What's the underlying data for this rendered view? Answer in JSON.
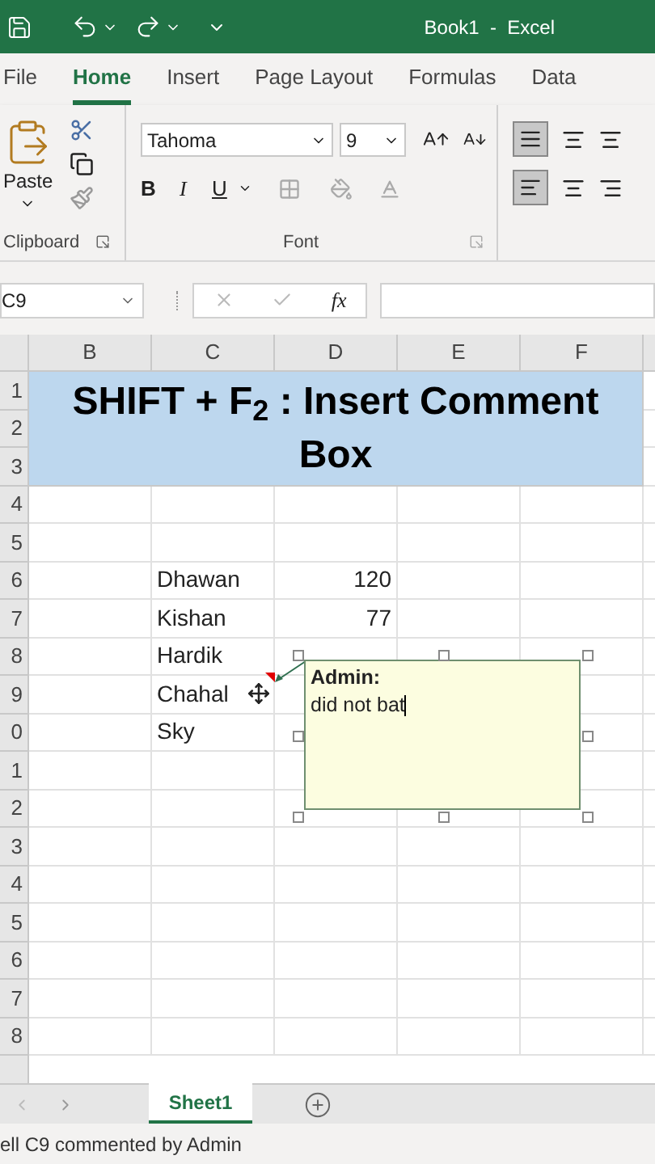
{
  "title_bar": {
    "title": "Book1  -  Excel"
  },
  "ribbon_tabs": [
    {
      "label": "File",
      "selected": false
    },
    {
      "label": "Home",
      "selected": true
    },
    {
      "label": "Insert",
      "selected": false
    },
    {
      "label": "Page Layout",
      "selected": false
    },
    {
      "label": "Formulas",
      "selected": false
    },
    {
      "label": "Data",
      "selected": false
    }
  ],
  "ribbon": {
    "paste_label": "Paste",
    "clipboard_label": "Clipboard",
    "font_name": "Tahoma",
    "font_size": "9",
    "bold": "B",
    "italic": "I",
    "underline": "U",
    "font_label": "Font"
  },
  "formula_bar": {
    "name_box": "C9",
    "function_label": "fx"
  },
  "sheet": {
    "columns": [
      "B",
      "C",
      "D",
      "E",
      "F"
    ],
    "banner": "SHIFT + F$_{2}$ : Insert Comment Box",
    "rows": [
      {
        "number": "1"
      },
      {
        "number": "2"
      },
      {
        "number": "3"
      },
      {
        "number": "4"
      },
      {
        "number": "5"
      },
      {
        "number": "6",
        "c": "Dhawan",
        "d": "120"
      },
      {
        "number": "7",
        "c": "Kishan",
        "d": "77"
      },
      {
        "number": "8",
        "c": "Hardik"
      },
      {
        "number": "9",
        "c": "Chahal"
      },
      {
        "number": "0",
        "c": "Sky"
      },
      {
        "number": "1"
      },
      {
        "number": "2"
      },
      {
        "number": "3"
      },
      {
        "number": "4"
      },
      {
        "number": "5"
      },
      {
        "number": "6"
      },
      {
        "number": "7"
      },
      {
        "number": "8"
      }
    ],
    "comment": {
      "author": "Admin:",
      "text": "did not bat"
    }
  },
  "sheet_tabs": [
    {
      "label": "Sheet1",
      "selected": true
    }
  ],
  "status_bar": {
    "text": "ell C9 commented by Admin"
  }
}
